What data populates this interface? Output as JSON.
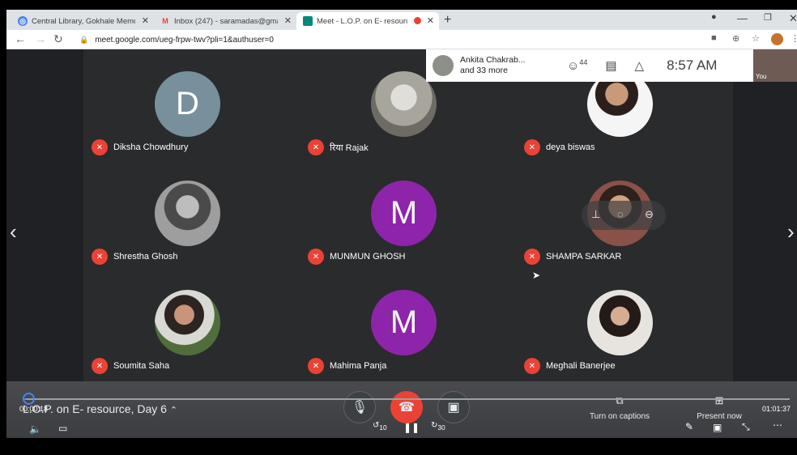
{
  "browser": {
    "tabs": [
      {
        "label": "Central Library, Gokhale Memori",
        "icon": "globe-icon",
        "active": false
      },
      {
        "label": "Inbox (247) - saramadas@gmail.c",
        "icon": "gmail-icon",
        "active": false
      },
      {
        "label": "Meet - L.O.P. on E- resource",
        "icon": "meet-icon",
        "active": true
      }
    ],
    "url": "meet.google.com/ueg-frpw-twv?pli=1&authuser=0"
  },
  "meet": {
    "top_bar": {
      "presenter": "Ankita Chakrab...",
      "more": "and 33 more",
      "participants_count": "44",
      "time": "8:57 AM",
      "self_label": "You"
    },
    "meeting_name": "L.O.P. on E- resource, Day 6",
    "participants": [
      {
        "name": "Diksha Chowdhury",
        "initial": "D",
        "color": "#78909c"
      },
      {
        "name": "रिया Rajak",
        "initial": "",
        "color": ""
      },
      {
        "name": "deya biswas",
        "initial": "",
        "color": ""
      },
      {
        "name": "Shrestha Ghosh",
        "initial": "",
        "color": ""
      },
      {
        "name": "MUNMUN GHOSH",
        "initial": "M",
        "color": "#8e24aa"
      },
      {
        "name": "SHAMPA SARKAR",
        "initial": "",
        "color": ""
      },
      {
        "name": "Soumita Saha",
        "initial": "",
        "color": ""
      },
      {
        "name": "Mahima Panja",
        "initial": "M",
        "color": "#8e24aa"
      },
      {
        "name": "Meghali Banerjee",
        "initial": "",
        "color": ""
      }
    ],
    "controls": {
      "captions_label": "Turn on captions",
      "present_label": "Present now"
    }
  },
  "video_player": {
    "elapsed": "00:00:18",
    "duration": "01:01:37",
    "skip_back": "10",
    "skip_forward": "30"
  }
}
